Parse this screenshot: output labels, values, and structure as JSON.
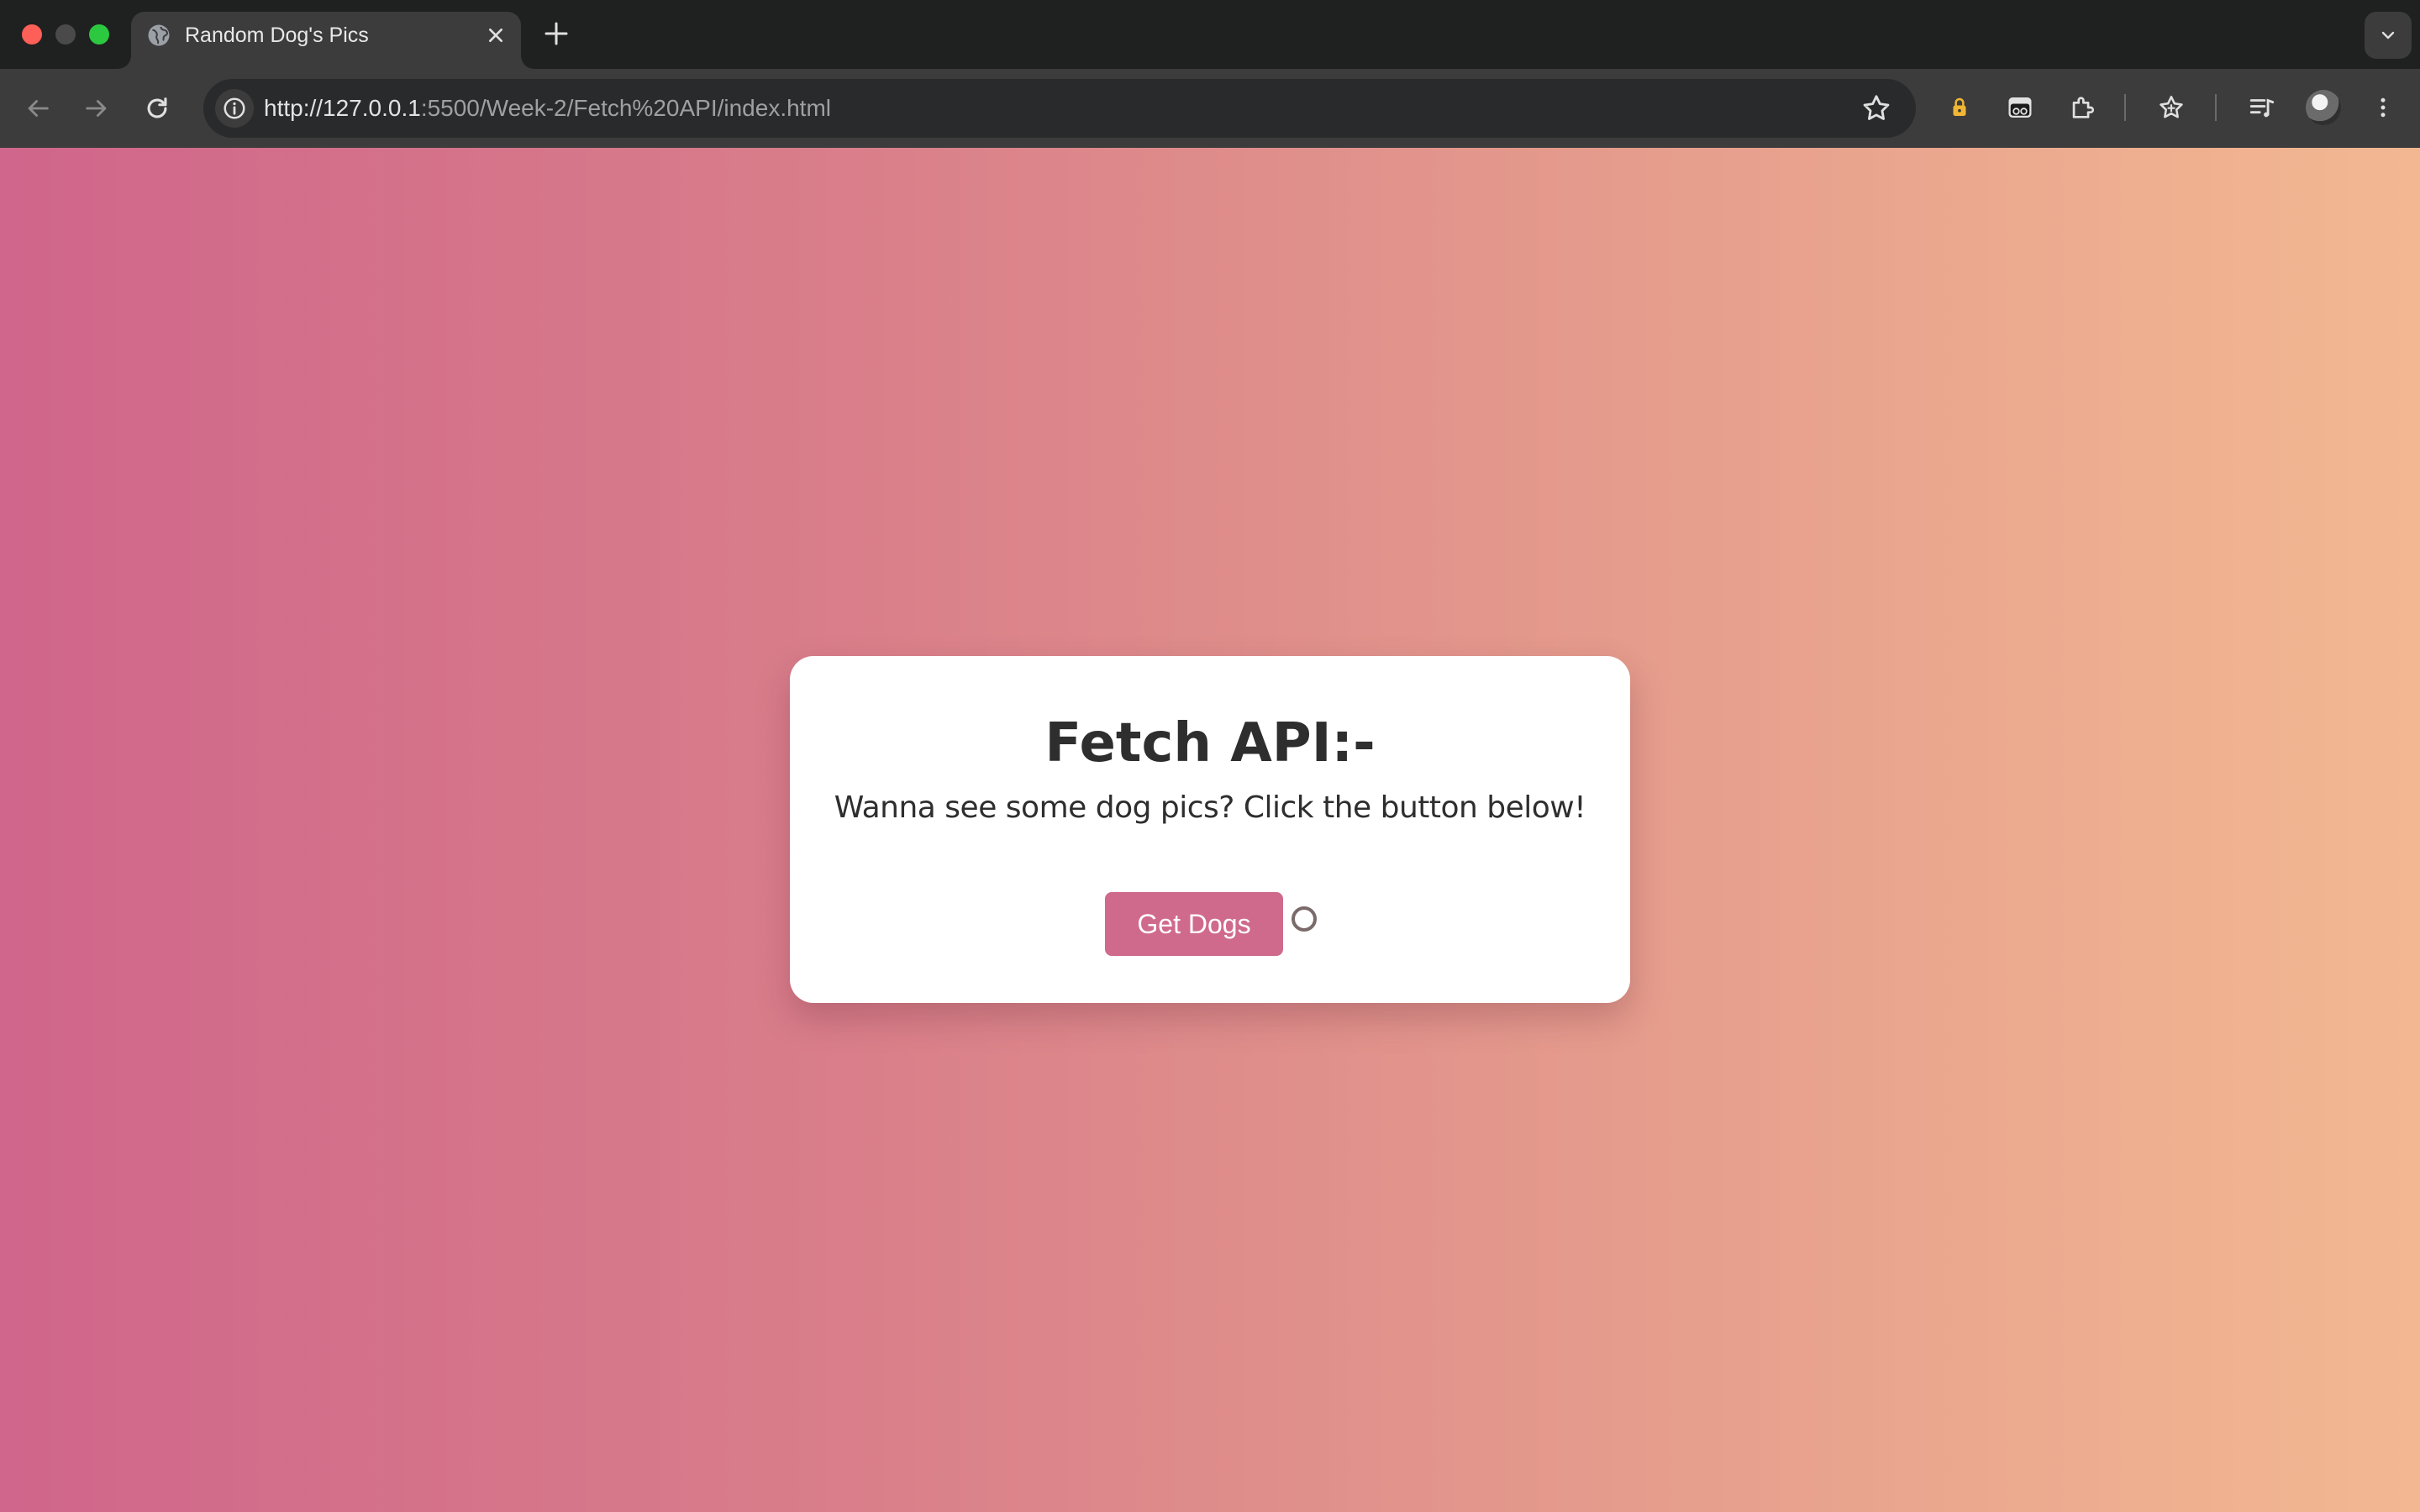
{
  "browser": {
    "tab": {
      "title": "Random Dog's Pics",
      "favicon": "globe-icon"
    },
    "address_bar": {
      "url_host": "http://127.0.0.1",
      "url_rest": ":5500/Week-2/Fetch%20API/index.html"
    },
    "toolbar_icons": [
      "back-icon",
      "forward-icon",
      "reload-icon",
      "site-info-icon",
      "bookmark-star-icon",
      "lock-extension-icon",
      "mask-extension-icon",
      "extensions-puzzle-icon",
      "favorites-icon",
      "media-control-icon",
      "profile-avatar",
      "more-menu-icon"
    ]
  },
  "page": {
    "title": "Fetch API:-",
    "subtitle": "Wanna see some dog pics? Click the button below!",
    "button_label": "Get Dogs"
  },
  "colors": {
    "gradient_start": "#d0668b",
    "gradient_end": "#f3b892",
    "button": "#cf6a8d",
    "card": "#ffffff"
  }
}
